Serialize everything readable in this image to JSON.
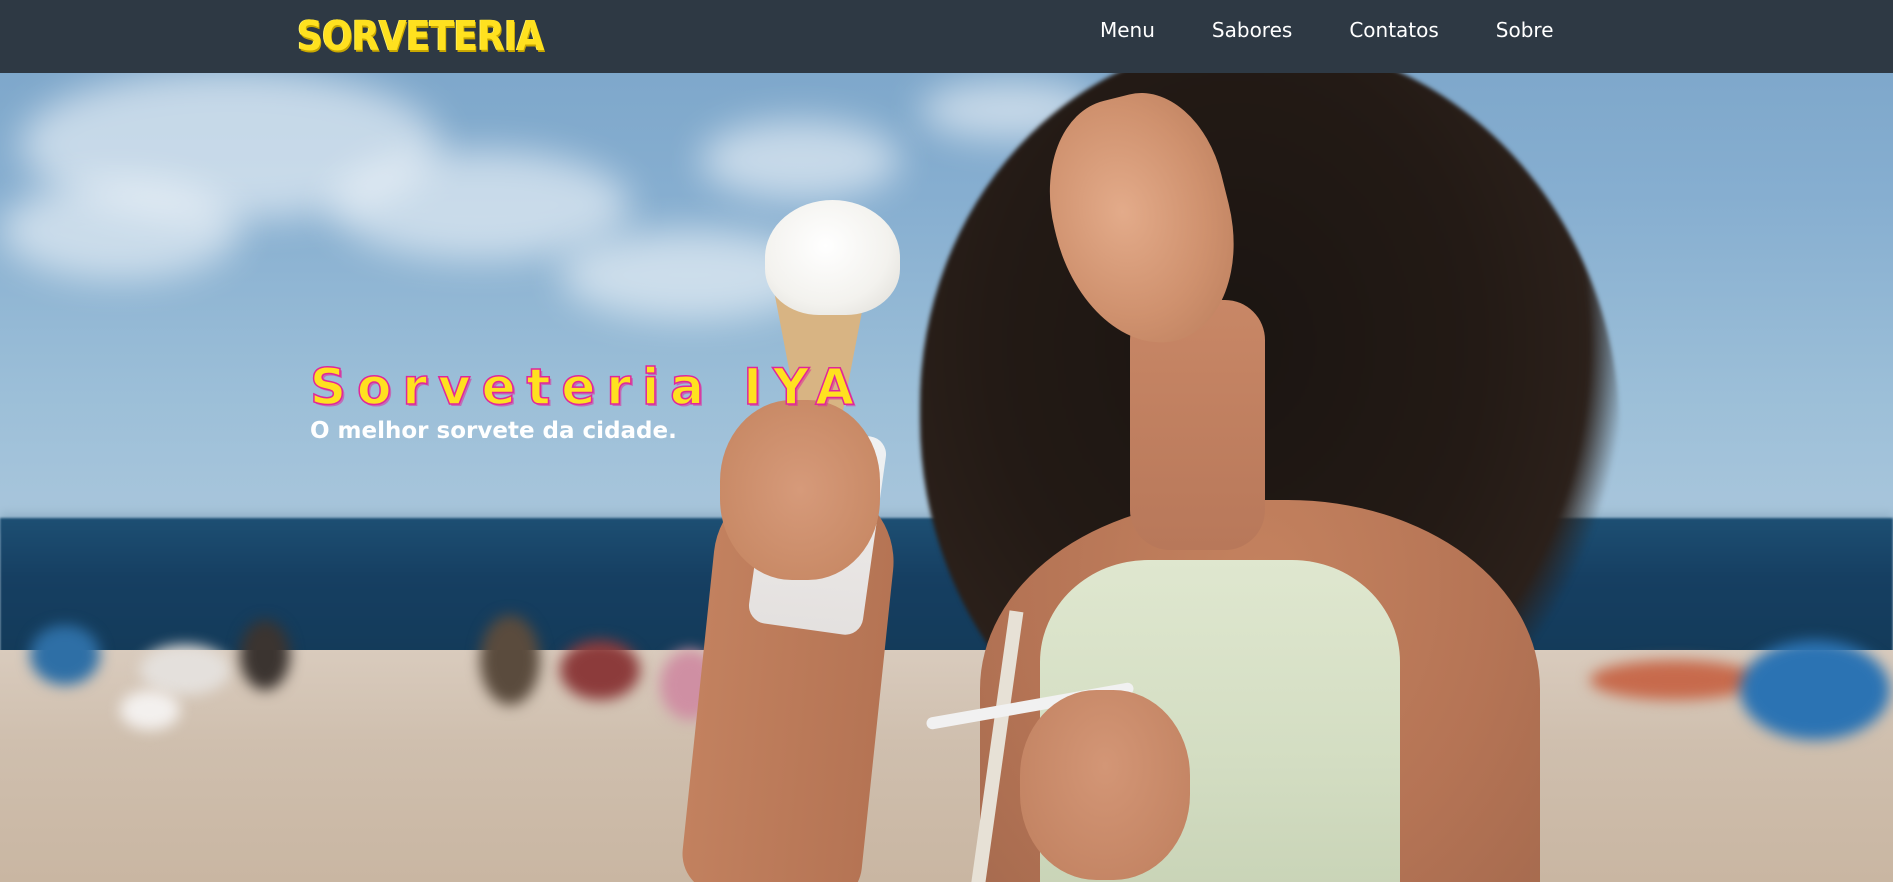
{
  "header": {
    "logo_text": "SORVETERIA",
    "nav": [
      {
        "label": "Menu"
      },
      {
        "label": "Sabores"
      },
      {
        "label": "Contatos"
      },
      {
        "label": "Sobre"
      }
    ]
  },
  "hero": {
    "title": "Sorveteria IYA",
    "subtitle": "O melhor sorvete da cidade.",
    "image_subject": "woman-eating-ice-cream-at-beach"
  },
  "colors": {
    "header_bg": "#2e3944",
    "logo": "#ffe11f",
    "title_fill": "#ffe11f",
    "title_outline": "#e0279a",
    "nav_text": "#ffffff",
    "subtitle": "#ffffff"
  }
}
